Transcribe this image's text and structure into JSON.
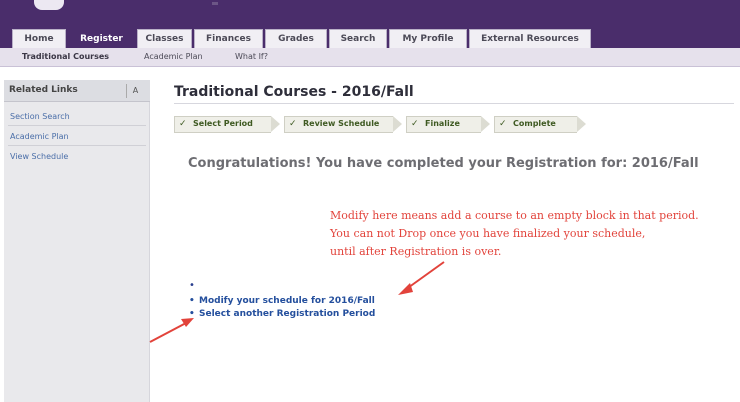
{
  "tabs": [
    {
      "label": "Home"
    },
    {
      "label": "Register"
    },
    {
      "label": "Classes"
    },
    {
      "label": "Finances"
    },
    {
      "label": "Grades"
    },
    {
      "label": "Search"
    },
    {
      "label": "My Profile"
    },
    {
      "label": "External Resources"
    }
  ],
  "sub_nav": [
    {
      "label": "Traditional Courses"
    },
    {
      "label": "Academic Plan"
    },
    {
      "label": "What If?"
    }
  ],
  "sidebar": {
    "title": "Related Links",
    "toggle": "A",
    "links": [
      {
        "label": "Section Search"
      },
      {
        "label": "Academic Plan"
      },
      {
        "label": "View Schedule"
      }
    ]
  },
  "main": {
    "title": "Traditional Courses - 2016/Fall",
    "steps": [
      {
        "label": "Select Period"
      },
      {
        "label": "Review Schedule"
      },
      {
        "label": "Finalize"
      },
      {
        "label": "Complete"
      }
    ],
    "congrats": "Congratulations! You have completed your Registration for: 2016/Fall",
    "actions": [
      {
        "label": "Modify your schedule for 2016/Fall"
      },
      {
        "label": "Select another Registration Period"
      }
    ]
  },
  "annotation": {
    "lines": [
      "Modify here means add a course to an empty block in that period.",
      "You can not Drop once you have finalized your schedule,",
      "until after Registration is over."
    ],
    "color": "#e2433b"
  },
  "colors": {
    "brand": "#4a2d6b",
    "link": "#244f9d",
    "step_text": "#3f5a22"
  }
}
